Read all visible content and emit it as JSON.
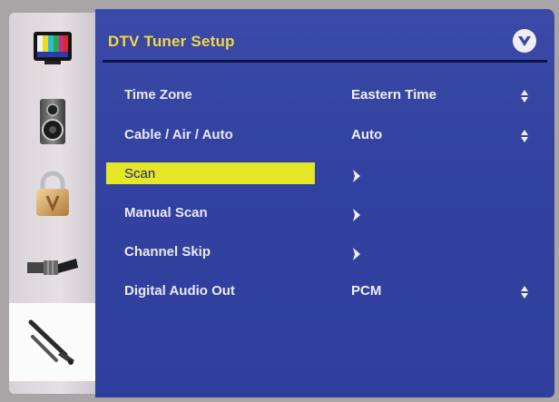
{
  "menu": {
    "title": "DTV Tuner Setup",
    "items": [
      {
        "label": "Time Zone",
        "value": "Eastern Time",
        "control": "up-down"
      },
      {
        "label": "Cable / Air / Auto",
        "value": "Auto",
        "control": "up-down"
      },
      {
        "label": "Scan",
        "value": "",
        "control": "submenu",
        "selected": true
      },
      {
        "label": "Manual Scan",
        "value": "",
        "control": "submenu"
      },
      {
        "label": "Channel Skip",
        "value": "",
        "control": "submenu"
      },
      {
        "label": "Digital Audio Out",
        "value": "PCM",
        "control": "up-down"
      }
    ]
  },
  "sidebar": {
    "icons": [
      "tv-picture-icon",
      "speaker-icon",
      "padlock-icon",
      "cable-connector-icon",
      "wrench-tools-icon"
    ],
    "selected": "wrench-tools-icon"
  },
  "colors": {
    "panel_blue": "#3342a0",
    "title_yellow": "#f2d64a",
    "highlight_yellow": "#e6e628",
    "sidebar_gray": "#e2dce1"
  }
}
